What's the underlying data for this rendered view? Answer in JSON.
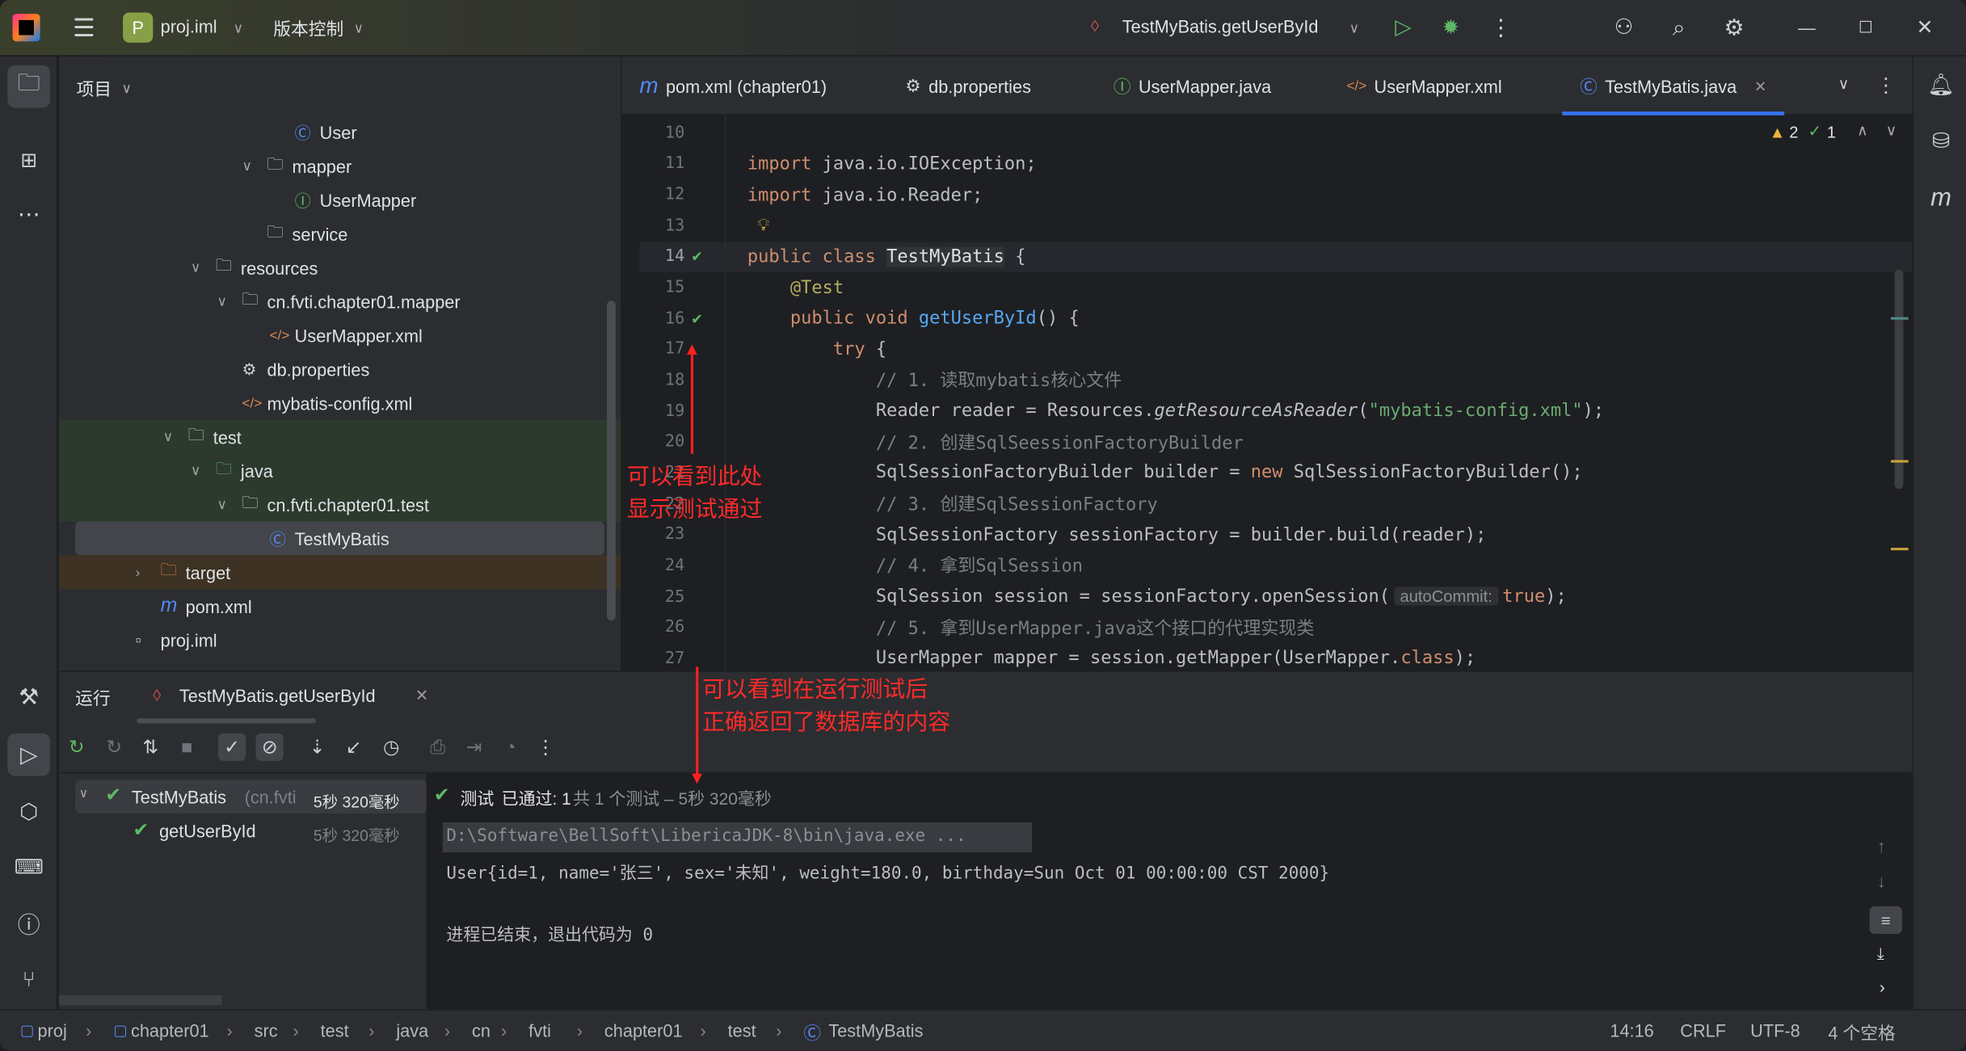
{
  "titlebar": {
    "project_badge": "P",
    "project": "proj.iml",
    "vcs": "版本控制",
    "run_config": "TestMyBatis.getUserById",
    "chevron": "∨"
  },
  "project_panel": {
    "title": "项目",
    "items": [
      {
        "label": "User",
        "icon": "class-icon",
        "indent": 235,
        "chev": null,
        "color": "#548af7"
      },
      {
        "label": "mapper",
        "icon": "package-folder-icon",
        "indent": 213,
        "chev": "open"
      },
      {
        "label": "UserMapper",
        "icon": "interface-icon",
        "indent": 235,
        "chev": null
      },
      {
        "label": "service",
        "icon": "package-folder-icon",
        "indent": 213,
        "chev": null
      },
      {
        "label": "resources",
        "icon": "resources-folder-icon",
        "indent": 172,
        "chev": "open"
      },
      {
        "label": "cn.fvti.chapter01.mapper",
        "icon": "folder-icon",
        "indent": 193,
        "chev": "open"
      },
      {
        "label": "UserMapper.xml",
        "icon": "xml-icon",
        "indent": 215,
        "chev": null
      },
      {
        "label": "db.properties",
        "icon": "gear-icon",
        "indent": 193,
        "chev": null
      },
      {
        "label": "mybatis-config.xml",
        "icon": "xml-icon",
        "indent": 193,
        "chev": null
      },
      {
        "label": "test",
        "icon": "folder-icon",
        "indent": 150,
        "chev": "open"
      },
      {
        "label": "java",
        "icon": "test-folder-icon",
        "indent": 172,
        "chev": "open"
      },
      {
        "label": "cn.fvti.chapter01.test",
        "icon": "package-folder-icon",
        "indent": 193,
        "chev": "open"
      },
      {
        "label": "TestMyBatis",
        "icon": "class-icon",
        "indent": 215,
        "chev": null
      },
      {
        "label": "target",
        "icon": "excluded-folder-icon",
        "indent": 128,
        "chev": "closed"
      },
      {
        "label": "pom.xml",
        "icon": "maven-icon",
        "indent": 128,
        "chev": null
      },
      {
        "label": "proj.iml",
        "icon": "file-icon",
        "indent": 108,
        "chev": null
      }
    ]
  },
  "editor": {
    "tabs": [
      {
        "label": "pom.xml (chapter01)",
        "icon": "maven-icon"
      },
      {
        "label": "db.properties",
        "icon": "gear-icon"
      },
      {
        "label": "UserMapper.java",
        "icon": "interface-icon"
      },
      {
        "label": "UserMapper.xml",
        "icon": "xml-icon"
      },
      {
        "label": "TestMyBatis.java",
        "icon": "class-icon",
        "active": true
      }
    ],
    "inspections": {
      "warnings": "2",
      "weak_warnings": "1"
    },
    "autocommit_hint": "autoCommit:",
    "lines": [
      {
        "n": "10",
        "t": []
      },
      {
        "n": "11",
        "t": [
          [
            "kw",
            "import "
          ],
          [
            "pl",
            "java.io.IOException;"
          ]
        ]
      },
      {
        "n": "12",
        "t": [
          [
            "kw",
            "import "
          ],
          [
            "pl",
            "java.io.Reader;"
          ]
        ]
      },
      {
        "n": "13",
        "t": []
      },
      {
        "n": "14",
        "t": [
          [
            "kw",
            "public class "
          ],
          [
            "hl",
            "TestMyBatis"
          ],
          [
            "pl",
            " {"
          ]
        ]
      },
      {
        "n": "15",
        "t": [
          [
            "pl",
            "    "
          ],
          [
            "an",
            "@Test"
          ]
        ]
      },
      {
        "n": "16",
        "t": [
          [
            "pl",
            "    "
          ],
          [
            "kw",
            "public void "
          ],
          [
            "fn",
            "getUserById"
          ],
          [
            "pl",
            "() {"
          ]
        ]
      },
      {
        "n": "17",
        "t": [
          [
            "pl",
            "        "
          ],
          [
            "kw",
            "try "
          ],
          [
            "pl",
            "{"
          ]
        ]
      },
      {
        "n": "18",
        "t": [
          [
            "pl",
            "            "
          ],
          [
            "cm",
            "// 1. 读取mybatis核心文件"
          ]
        ]
      },
      {
        "n": "19",
        "t": [
          [
            "pl",
            "            Reader reader = Resources."
          ],
          [
            "it",
            "getResourceAsReader"
          ],
          [
            "pl",
            "("
          ],
          [
            "str",
            "\"mybatis-config.xml\""
          ],
          [
            "pl",
            ");"
          ]
        ]
      },
      {
        "n": "20",
        "t": [
          [
            "pl",
            "            "
          ],
          [
            "cm",
            "// 2. 创建SqlSeessionFactoryBuilder"
          ]
        ]
      },
      {
        "n": "21",
        "t": [
          [
            "pl",
            "            SqlSessionFactoryBuilder builder = "
          ],
          [
            "kw",
            "new "
          ],
          [
            "pl",
            "SqlSessionFactoryBuilder();"
          ]
        ]
      },
      {
        "n": "22",
        "t": [
          [
            "pl",
            "            "
          ],
          [
            "cm",
            "// 3. 创建SqlSessionFactory"
          ]
        ]
      },
      {
        "n": "23",
        "t": [
          [
            "pl",
            "            SqlSessionFactory sessionFactory = builder.build(reader);"
          ]
        ]
      },
      {
        "n": "24",
        "t": [
          [
            "pl",
            "            "
          ],
          [
            "cm",
            "// 4. 拿到SqlSession"
          ]
        ]
      },
      {
        "n": "25",
        "t": [
          [
            "pl",
            "            SqlSession session = sessionFactory.openSession("
          ],
          [
            "hint",
            "autoCommit:"
          ],
          [
            "kw",
            "true"
          ],
          [
            "pl",
            ");"
          ]
        ]
      },
      {
        "n": "26",
        "t": [
          [
            "pl",
            "            "
          ],
          [
            "cm",
            "// 5. 拿到UserMapper.java这个接口的代理实现类"
          ]
        ]
      },
      {
        "n": "27",
        "t": [
          [
            "pl",
            "            UserMapper mapper = session.getMapper(UserMapper."
          ],
          [
            "kw",
            "class"
          ],
          [
            "pl",
            ");"
          ]
        ]
      }
    ]
  },
  "run_panel": {
    "title": "运行",
    "tab": "TestMyBatis.getUserById",
    "tree": [
      {
        "label": "TestMyBatis",
        "pkg": "(cn.fvti",
        "time": "5秒 320毫秒"
      },
      {
        "label": "getUserById",
        "time": "5秒 320毫秒"
      }
    ],
    "summary": {
      "prefix": "测试",
      "passed": "已通过: 1",
      "total": "共 1 个测试 – 5秒 320毫秒"
    },
    "console": [
      "D:\\Software\\BellSoft\\LibericaJDK-8\\bin\\java.exe ...",
      "User{id=1, name='张三', sex='未知', weight=180.0, birthday=Sun Oct 01 00:00:00 CST 2000}",
      "进程已结束，退出代码为 0"
    ]
  },
  "annotations": {
    "a1": [
      "可以看到此处",
      "显示测试通过"
    ],
    "a2": [
      "可以看到在运行测试后",
      "正确返回了数据库的内容"
    ],
    "color": "#ff2020"
  },
  "statusbar": {
    "breadcrumbs": [
      "proj",
      "chapter01",
      "src",
      "test",
      "java",
      "cn",
      "fvti",
      "chapter01",
      "test",
      "TestMyBatis"
    ],
    "position": "14:16",
    "line_sep": "CRLF",
    "encoding": "UTF-8",
    "indent": "4 个空格"
  }
}
